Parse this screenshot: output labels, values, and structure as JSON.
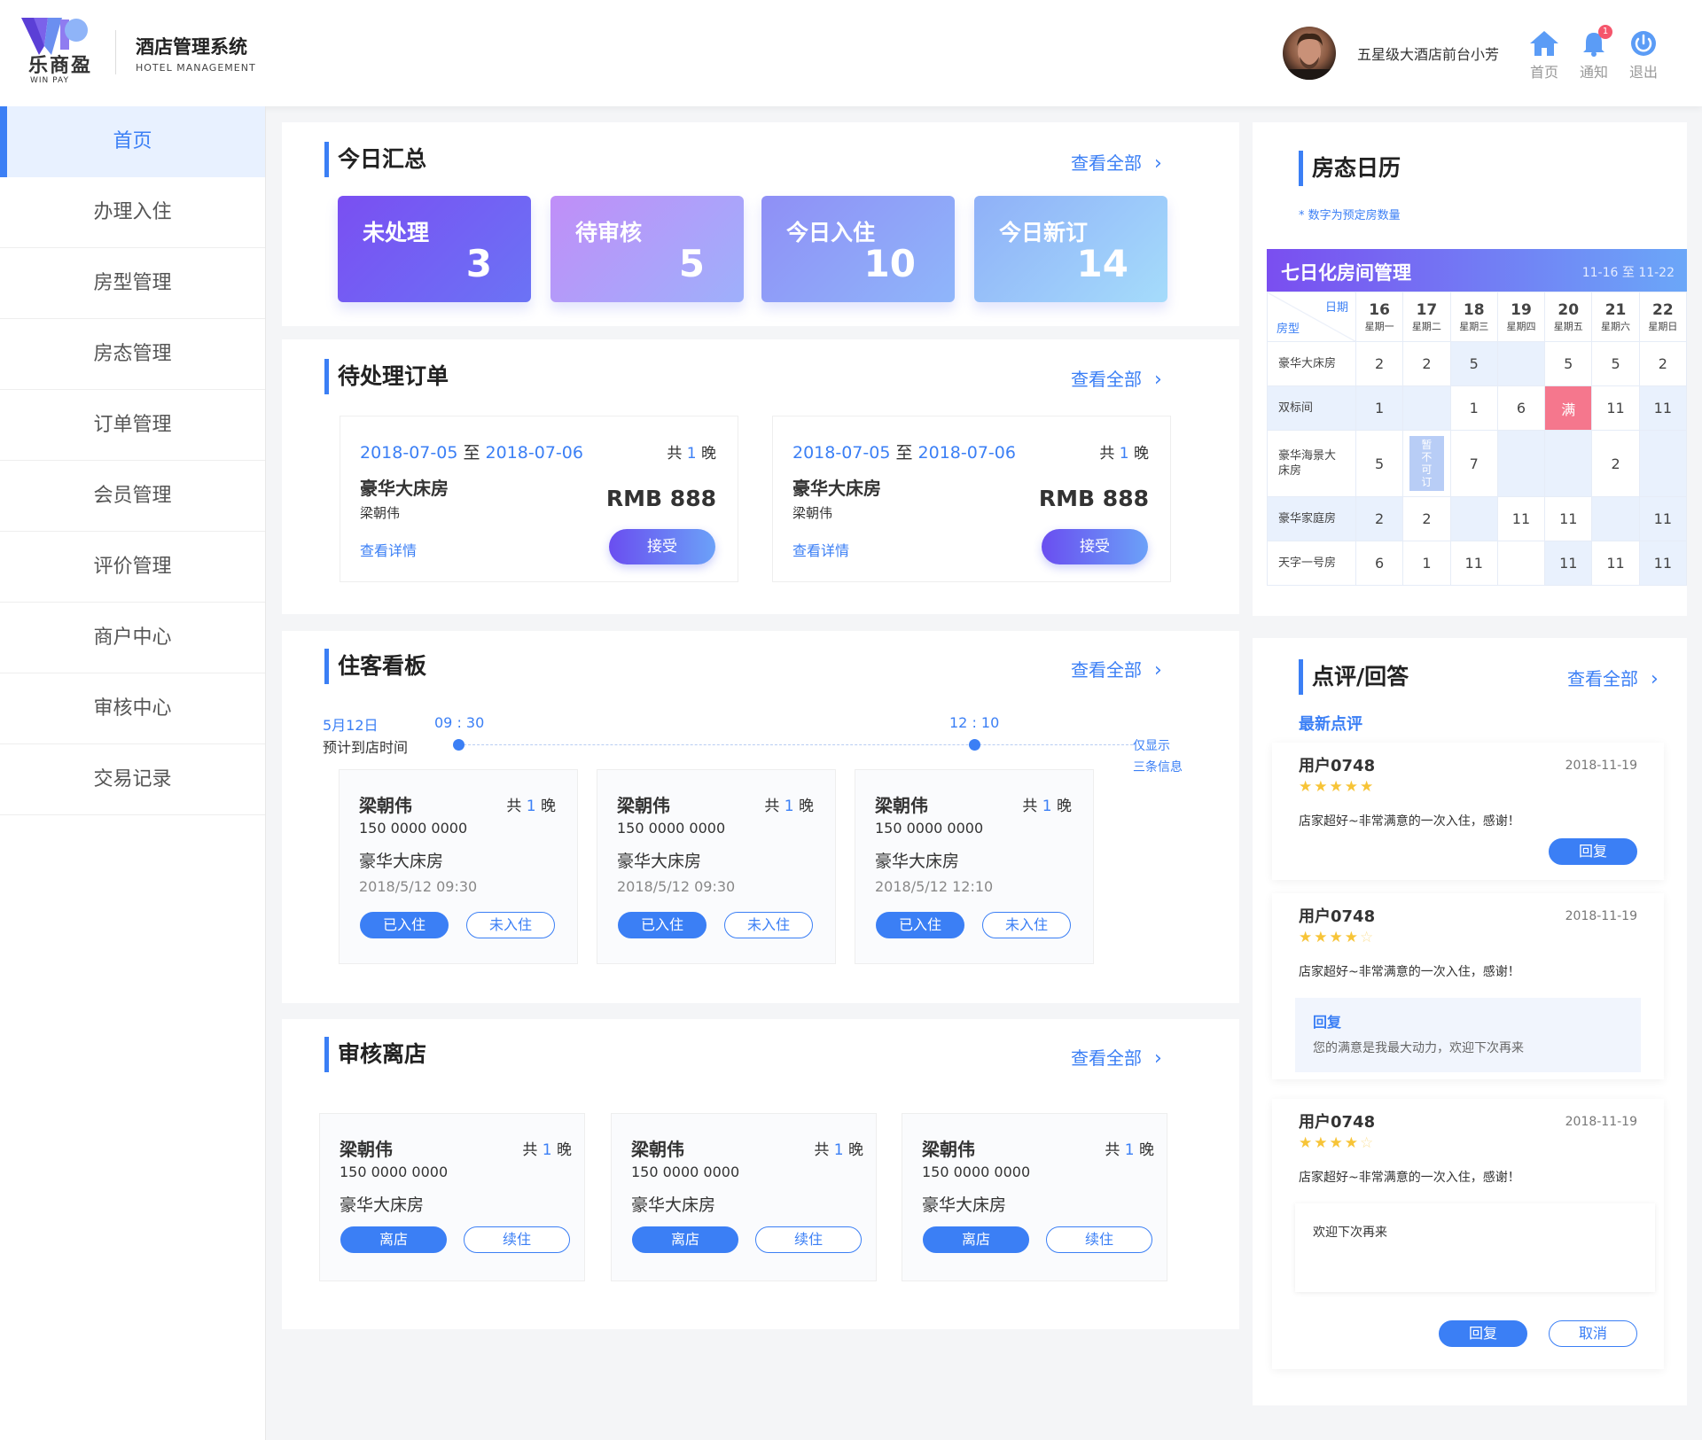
{
  "header": {
    "logo_cn": "乐商盈",
    "logo_en": "WIN PAY",
    "title": "酒店管理系统",
    "subtitle": "HOTEL MANAGEMENT",
    "user": "五星级大酒店前台小芳",
    "home": "首页",
    "notify": "通知",
    "notify_badge": "1",
    "logout": "退出"
  },
  "sidebar": {
    "items": [
      {
        "label": "首页"
      },
      {
        "label": "办理入住"
      },
      {
        "label": "房型管理"
      },
      {
        "label": "房态管理"
      },
      {
        "label": "订单管理"
      },
      {
        "label": "会员管理"
      },
      {
        "label": "评价管理"
      },
      {
        "label": "商户中心"
      },
      {
        "label": "审核中心"
      },
      {
        "label": "交易记录"
      }
    ]
  },
  "summary": {
    "title": "今日汇总",
    "more": "查看全部",
    "cards": [
      {
        "label": "未处理",
        "value": "3"
      },
      {
        "label": "待审核",
        "value": "5"
      },
      {
        "label": "今日入住",
        "value": "10"
      },
      {
        "label": "今日新订",
        "value": "14"
      }
    ]
  },
  "orders": {
    "title": "待处理订单",
    "more": "查看全部",
    "items": [
      {
        "from": "2018-07-05",
        "sep": "至",
        "to": "2018-07-06",
        "total_pre": "共",
        "nights": "1",
        "total_post": "晚",
        "room": "豪华大床房",
        "guest": "梁朝伟",
        "price": "RMB 888",
        "detail": "查看详情",
        "accept": "接受"
      },
      {
        "from": "2018-07-05",
        "sep": "至",
        "to": "2018-07-06",
        "total_pre": "共",
        "nights": "1",
        "total_post": "晚",
        "room": "豪华大床房",
        "guest": "梁朝伟",
        "price": "RMB 888",
        "detail": "查看详情",
        "accept": "接受"
      }
    ]
  },
  "board": {
    "title": "住客看板",
    "more": "查看全部",
    "date": "5月12日",
    "arrive_label": "预计到店时间",
    "times": [
      "09 : 30",
      "12 : 10"
    ],
    "note_line1": "仅显示",
    "note_line2": "三条信息",
    "guests": [
      {
        "name": "梁朝伟",
        "total_pre": "共",
        "nights": "1",
        "total_post": "晚",
        "phone": "150 0000 0000",
        "room": "豪华大床房",
        "time": "2018/5/12 09:30",
        "in": "已入住",
        "notin": "未入住"
      },
      {
        "name": "梁朝伟",
        "total_pre": "共",
        "nights": "1",
        "total_post": "晚",
        "phone": "150 0000 0000",
        "room": "豪华大床房",
        "time": "2018/5/12 09:30",
        "in": "已入住",
        "notin": "未入住"
      },
      {
        "name": "梁朝伟",
        "total_pre": "共",
        "nights": "1",
        "total_post": "晚",
        "phone": "150 0000 0000",
        "room": "豪华大床房",
        "time": "2018/5/12 12:10",
        "in": "已入住",
        "notin": "未入住"
      }
    ]
  },
  "checkout": {
    "title": "审核离店",
    "more": "查看全部",
    "guests": [
      {
        "name": "梁朝伟",
        "total_pre": "共",
        "nights": "1",
        "total_post": "晚",
        "phone": "150 0000 0000",
        "room": "豪华大床房",
        "leave": "离店",
        "extend": "续住"
      },
      {
        "name": "梁朝伟",
        "total_pre": "共",
        "nights": "1",
        "total_post": "晚",
        "phone": "150 0000 0000",
        "room": "豪华大床房",
        "leave": "离店",
        "extend": "续住"
      },
      {
        "name": "梁朝伟",
        "total_pre": "共",
        "nights": "1",
        "total_post": "晚",
        "phone": "150 0000 0000",
        "room": "豪华大床房",
        "leave": "离店",
        "extend": "续住"
      }
    ]
  },
  "calendar": {
    "title": "房态日历",
    "hint": "* 数字为预定房数量",
    "head_title": "七日化房间管理",
    "range": "11-16 至 11-22",
    "corner_date": "日期",
    "corner_room": "房型",
    "days": [
      {
        "d": "16",
        "w": "星期一"
      },
      {
        "d": "17",
        "w": "星期二"
      },
      {
        "d": "18",
        "w": "星期三"
      },
      {
        "d": "19",
        "w": "星期四"
      },
      {
        "d": "20",
        "w": "星期五"
      },
      {
        "d": "21",
        "w": "星期六"
      },
      {
        "d": "22",
        "w": "星期日"
      }
    ],
    "rows": [
      {
        "name": "豪华大床房",
        "cells": [
          "2",
          "2",
          "5",
          "",
          "5",
          "5",
          "2"
        ]
      },
      {
        "name": "双标间",
        "cells": [
          "1",
          "",
          "1",
          "6",
          "满",
          "11",
          "11"
        ]
      },
      {
        "name": "豪华海景大床房",
        "cells": [
          "5",
          "暂不可订",
          "7",
          "",
          "",
          "2",
          ""
        ]
      },
      {
        "name": "豪华家庭房",
        "cells": [
          "2",
          "2",
          "",
          "11",
          "11",
          "",
          "11"
        ]
      },
      {
        "name": "天字一号房",
        "cells": [
          "6",
          "1",
          "11",
          "",
          "11",
          "11",
          "11"
        ]
      }
    ]
  },
  "reviews": {
    "title": "点评/回答",
    "more": "查看全部",
    "sub": "最新点评",
    "items": [
      {
        "user": "用户0748",
        "date": "2018-11-19",
        "rating": 5,
        "text": "店家超好~非常满意的一次入住，感谢！",
        "reply_btn": "回复"
      },
      {
        "user": "用户0748",
        "date": "2018-11-19",
        "rating": 4,
        "text": "店家超好~非常满意的一次入住，感谢！",
        "reply_title": "回复",
        "reply_text": "您的满意是我最大动力，欢迎下次再来"
      },
      {
        "user": "用户0748",
        "date": "2018-11-19",
        "rating": 4,
        "text": "店家超好~非常满意的一次入住，感谢！",
        "input_value": "欢迎下次再来",
        "reply_btn": "回复",
        "cancel_btn": "取消"
      }
    ]
  },
  "colors": {
    "accent": "#3b7ff5",
    "full": "#f5778d",
    "star": "#f7c437"
  }
}
